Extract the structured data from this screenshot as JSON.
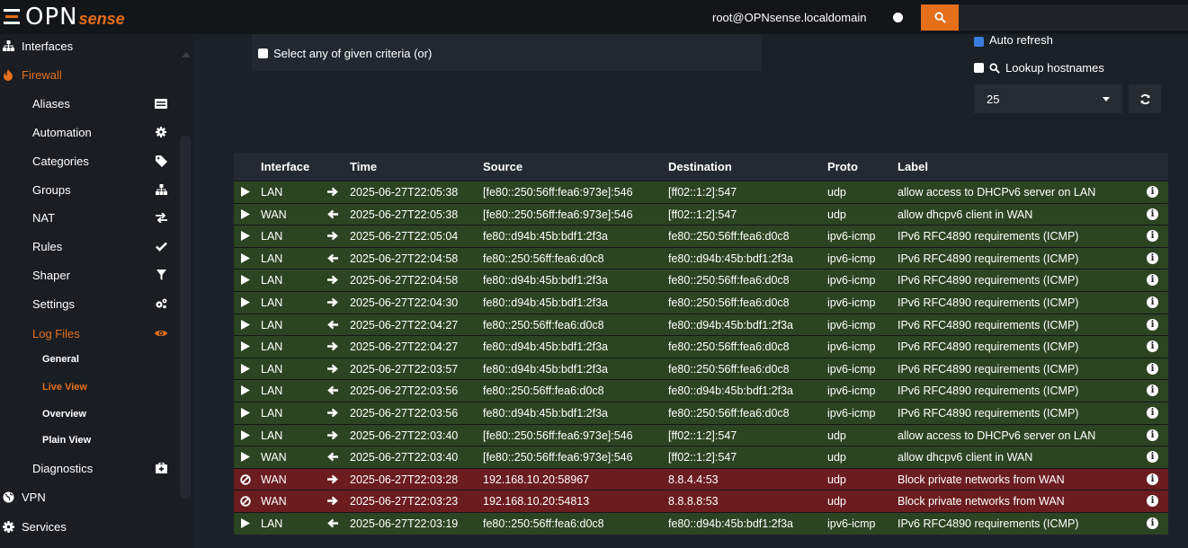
{
  "header": {
    "logo_main": "OPN",
    "logo_sense": "sense",
    "user": "root@OPNsense.localdomain",
    "search_placeholder": ""
  },
  "sidebar": {
    "items": [
      {
        "label": "Interfaces",
        "icon": "sitemap-icon",
        "level": "top"
      },
      {
        "label": "Firewall",
        "icon": "fire-icon",
        "level": "top",
        "active": true
      },
      {
        "label": "Aliases",
        "icon": "list-icon",
        "level": "child"
      },
      {
        "label": "Automation",
        "icon": "gear-icon",
        "level": "child"
      },
      {
        "label": "Categories",
        "icon": "tag-icon",
        "level": "child"
      },
      {
        "label": "Groups",
        "icon": "sitemap-icon",
        "level": "child"
      },
      {
        "label": "NAT",
        "icon": "exchange-icon",
        "level": "child"
      },
      {
        "label": "Rules",
        "icon": "check-icon",
        "level": "child"
      },
      {
        "label": "Shaper",
        "icon": "filter-icon",
        "level": "child"
      },
      {
        "label": "Settings",
        "icon": "gears-icon",
        "level": "child"
      },
      {
        "label": "Log Files",
        "icon": "eye-icon",
        "level": "child",
        "active": true
      },
      {
        "label": "General",
        "level": "sub"
      },
      {
        "label": "Live View",
        "level": "sub",
        "active": true
      },
      {
        "label": "Overview",
        "level": "sub"
      },
      {
        "label": "Plain View",
        "level": "sub"
      },
      {
        "label": "Diagnostics",
        "icon": "medkit-icon",
        "level": "child"
      },
      {
        "label": "VPN",
        "icon": "globe-icon",
        "level": "top"
      },
      {
        "label": "Services",
        "icon": "cog-icon",
        "level": "top"
      }
    ]
  },
  "filters": {
    "select_any_label": "Select any of given criteria (or)",
    "auto_refresh_label": "Auto refresh",
    "lookup_label": "Lookup hostnames",
    "limit_value": "25"
  },
  "table": {
    "headers": {
      "interface": "Interface",
      "time": "Time",
      "source": "Source",
      "destination": "Destination",
      "proto": "Proto",
      "label": "Label"
    },
    "rows": [
      {
        "action": "pass",
        "interface": "LAN",
        "dir": "in",
        "time": "2025-06-27T22:05:38",
        "source": "[fe80::250:56ff:fea6:973e]:546",
        "destination": "[ff02::1:2]:547",
        "proto": "udp",
        "label": "allow access to DHCPv6 server on LAN"
      },
      {
        "action": "pass",
        "interface": "WAN",
        "dir": "out",
        "time": "2025-06-27T22:05:38",
        "source": "[fe80::250:56ff:fea6:973e]:546",
        "destination": "[ff02::1:2]:547",
        "proto": "udp",
        "label": "allow dhcpv6 client in WAN"
      },
      {
        "action": "pass",
        "interface": "LAN",
        "dir": "in",
        "time": "2025-06-27T22:05:04",
        "source": "fe80::d94b:45b:bdf1:2f3a",
        "destination": "fe80::250:56ff:fea6:d0c8",
        "proto": "ipv6-icmp",
        "label": "IPv6 RFC4890 requirements (ICMP)"
      },
      {
        "action": "pass",
        "interface": "LAN",
        "dir": "out",
        "time": "2025-06-27T22:04:58",
        "source": "fe80::250:56ff:fea6:d0c8",
        "destination": "fe80::d94b:45b:bdf1:2f3a",
        "proto": "ipv6-icmp",
        "label": "IPv6 RFC4890 requirements (ICMP)"
      },
      {
        "action": "pass",
        "interface": "LAN",
        "dir": "in",
        "time": "2025-06-27T22:04:58",
        "source": "fe80::d94b:45b:bdf1:2f3a",
        "destination": "fe80::250:56ff:fea6:d0c8",
        "proto": "ipv6-icmp",
        "label": "IPv6 RFC4890 requirements (ICMP)"
      },
      {
        "action": "pass",
        "interface": "LAN",
        "dir": "in",
        "time": "2025-06-27T22:04:30",
        "source": "fe80::d94b:45b:bdf1:2f3a",
        "destination": "fe80::250:56ff:fea6:d0c8",
        "proto": "ipv6-icmp",
        "label": "IPv6 RFC4890 requirements (ICMP)"
      },
      {
        "action": "pass",
        "interface": "LAN",
        "dir": "out",
        "time": "2025-06-27T22:04:27",
        "source": "fe80::250:56ff:fea6:d0c8",
        "destination": "fe80::d94b:45b:bdf1:2f3a",
        "proto": "ipv6-icmp",
        "label": "IPv6 RFC4890 requirements (ICMP)"
      },
      {
        "action": "pass",
        "interface": "LAN",
        "dir": "in",
        "time": "2025-06-27T22:04:27",
        "source": "fe80::d94b:45b:bdf1:2f3a",
        "destination": "fe80::250:56ff:fea6:d0c8",
        "proto": "ipv6-icmp",
        "label": "IPv6 RFC4890 requirements (ICMP)"
      },
      {
        "action": "pass",
        "interface": "LAN",
        "dir": "in",
        "time": "2025-06-27T22:03:57",
        "source": "fe80::d94b:45b:bdf1:2f3a",
        "destination": "fe80::250:56ff:fea6:d0c8",
        "proto": "ipv6-icmp",
        "label": "IPv6 RFC4890 requirements (ICMP)"
      },
      {
        "action": "pass",
        "interface": "LAN",
        "dir": "out",
        "time": "2025-06-27T22:03:56",
        "source": "fe80::250:56ff:fea6:d0c8",
        "destination": "fe80::d94b:45b:bdf1:2f3a",
        "proto": "ipv6-icmp",
        "label": "IPv6 RFC4890 requirements (ICMP)"
      },
      {
        "action": "pass",
        "interface": "LAN",
        "dir": "in",
        "time": "2025-06-27T22:03:56",
        "source": "fe80::d94b:45b:bdf1:2f3a",
        "destination": "fe80::250:56ff:fea6:d0c8",
        "proto": "ipv6-icmp",
        "label": "IPv6 RFC4890 requirements (ICMP)"
      },
      {
        "action": "pass",
        "interface": "LAN",
        "dir": "in",
        "time": "2025-06-27T22:03:40",
        "source": "[fe80::250:56ff:fea6:973e]:546",
        "destination": "[ff02::1:2]:547",
        "proto": "udp",
        "label": "allow access to DHCPv6 server on LAN"
      },
      {
        "action": "pass",
        "interface": "WAN",
        "dir": "out",
        "time": "2025-06-27T22:03:40",
        "source": "[fe80::250:56ff:fea6:973e]:546",
        "destination": "[ff02::1:2]:547",
        "proto": "udp",
        "label": "allow dhcpv6 client in WAN"
      },
      {
        "action": "block",
        "interface": "WAN",
        "dir": "in",
        "time": "2025-06-27T22:03:28",
        "source": "192.168.10.20:58967",
        "destination": "8.8.4.4:53",
        "proto": "udp",
        "label": "Block private networks from WAN"
      },
      {
        "action": "block",
        "interface": "WAN",
        "dir": "in",
        "time": "2025-06-27T22:03:23",
        "source": "192.168.10.20:54813",
        "destination": "8.8.8.8:53",
        "proto": "udp",
        "label": "Block private networks from WAN"
      },
      {
        "action": "pass",
        "interface": "LAN",
        "dir": "out",
        "time": "2025-06-27T22:03:19",
        "source": "fe80::250:56ff:fea6:d0c8",
        "destination": "fe80::d94b:45b:bdf1:2f3a",
        "proto": "ipv6-icmp",
        "label": "IPv6 RFC4890 requirements (ICMP)"
      }
    ]
  },
  "colors": {
    "accent": "#e56f1b",
    "pass_row": "#2d4422",
    "block_row": "#6b1c1f"
  }
}
